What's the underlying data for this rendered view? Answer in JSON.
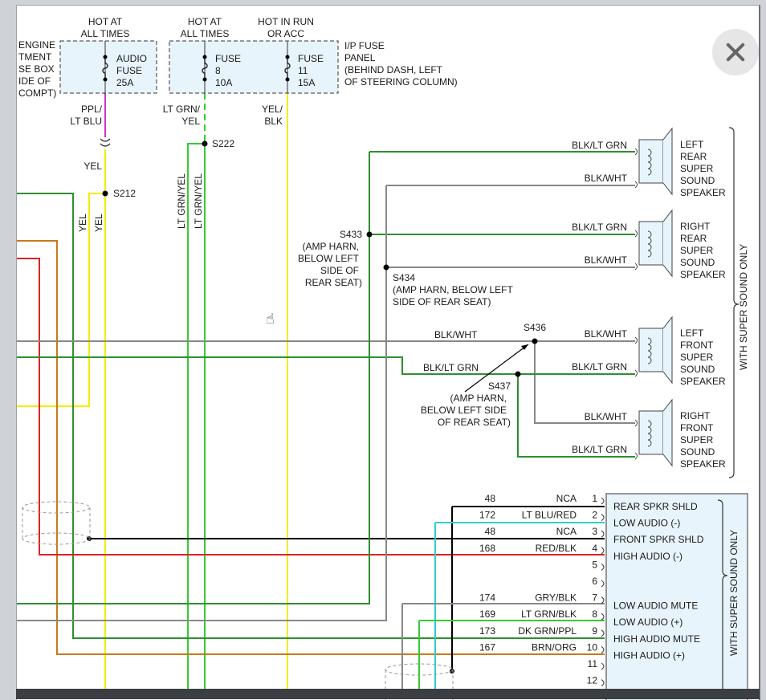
{
  "colors": {
    "yel": "#f0ee00",
    "grn": "#33cc33",
    "dkgrn": "#2f8f2f",
    "gry": "#888888",
    "red": "#dd2222",
    "orn": "#c87a1a",
    "blk": "#000000",
    "cyan": "#33cccc",
    "pur": "#cc33cc",
    "fuse_fill": "#e8f4fb"
  },
  "fuses": {
    "left": {
      "head": [
        "HOT AT",
        "ALL TIMES"
      ],
      "label": [
        "AUDIO",
        "FUSE",
        "25A"
      ],
      "box_label": [
        "ENGINE",
        "TMENT",
        "SE BOX",
        "IDE OF",
        "COMPT)"
      ]
    },
    "center": {
      "head1": [
        "HOT AT",
        "ALL TIMES"
      ],
      "head2": [
        "HOT IN RUN",
        "OR ACC"
      ],
      "f1": [
        "FUSE",
        "8",
        "10A"
      ],
      "f2": [
        "FUSE",
        "11",
        "15A"
      ],
      "panel": [
        "I/P FUSE",
        "PANEL",
        "(BEHIND DASH, LEFT",
        "OF STEERING COLUMN)"
      ]
    }
  },
  "wires": {
    "ppl_ltblu": [
      "PPL/",
      "LT BLU"
    ],
    "yel": "YEL",
    "yel_v1": "YEL",
    "yel_v2": "YEL",
    "ltgrn_yel": [
      "LT GRN/",
      "YEL"
    ],
    "ltgrn_yel_v1": "LT GRN/YEL",
    "ltgrn_yel_v2": "LT GRN/YEL",
    "yel_blk": [
      "YEL/",
      "BLK"
    ]
  },
  "splices": {
    "s212": "S212",
    "s222": "S222",
    "s433": "S433",
    "s433_note": [
      "(AMP HARN,",
      "BELOW LEFT",
      "SIDE OF",
      "REAR SEAT)"
    ],
    "s434": "S434",
    "s434_note": [
      "(AMP HARN, BELOW LEFT",
      "SIDE OF REAR SEAT)"
    ],
    "s436": "S436",
    "s437": "S437",
    "s437_note": [
      "(AMP HARN,",
      "BELOW LEFT SIDE",
      "OF REAR SEAT)"
    ]
  },
  "speakers": [
    {
      "wire_top": "BLK/LT GRN",
      "wire_bot": "BLK/WHT",
      "label": [
        "LEFT",
        "REAR",
        "SUPER",
        "SOUND",
        "SPEAKER"
      ]
    },
    {
      "wire_top": "BLK/LT GRN",
      "wire_bot": "BLK/WHT",
      "label": [
        "RIGHT",
        "REAR",
        "SUPER",
        "SOUND",
        "SPEAKER"
      ]
    },
    {
      "wire_top": "BLK/WHT",
      "wire_bot": "BLK/LT GRN",
      "label": [
        "LEFT",
        "FRONT",
        "SUPER",
        "SOUND",
        "SPEAKER"
      ]
    },
    {
      "wire_top": "BLK/WHT",
      "wire_bot": "BLK/LT GRN",
      "label": [
        "RIGHT",
        "FRONT",
        "SUPER",
        "SOUND",
        "SPEAKER"
      ]
    }
  ],
  "speaker_bracket": "WITH SUPER SOUND ONLY",
  "mid_wires": {
    "blk_wht": "BLK/WHT",
    "blk_ltgrn": "BLK/LT GRN"
  },
  "connector": {
    "bracket": "WITH SUPER SOUND ONLY",
    "pins": [
      {
        "circuit": "48",
        "color": "NCA",
        "pin": "1",
        "func": "REAR SPKR SHLD"
      },
      {
        "circuit": "172",
        "color": "LT BLU/RED",
        "pin": "2",
        "func": "LOW AUDIO (-)"
      },
      {
        "circuit": "48",
        "color": "NCA",
        "pin": "3",
        "func": "FRONT SPKR SHLD"
      },
      {
        "circuit": "168",
        "color": "RED/BLK",
        "pin": "4",
        "func": "HIGH AUDIO (-)"
      },
      {
        "circuit": "",
        "color": "",
        "pin": "5",
        "func": ""
      },
      {
        "circuit": "",
        "color": "",
        "pin": "6",
        "func": ""
      },
      {
        "circuit": "174",
        "color": "GRY/BLK",
        "pin": "7",
        "func": "LOW AUDIO MUTE"
      },
      {
        "circuit": "169",
        "color": "LT GRN/BLK",
        "pin": "8",
        "func": "LOW AUDIO (+)"
      },
      {
        "circuit": "173",
        "color": "DK GRN/PPL",
        "pin": "9",
        "func": "HIGH AUDIO MUTE"
      },
      {
        "circuit": "167",
        "color": "BRN/ORG",
        "pin": "10",
        "func": "HIGH AUDIO (+)"
      },
      {
        "circuit": "",
        "color": "",
        "pin": "11",
        "func": ""
      },
      {
        "circuit": "",
        "color": "",
        "pin": "12",
        "func": ""
      }
    ]
  },
  "ui": {
    "close_icon": "close-icon",
    "cursor_icon": "hand-pointer-icon",
    "cursor_glyph": "☝"
  }
}
